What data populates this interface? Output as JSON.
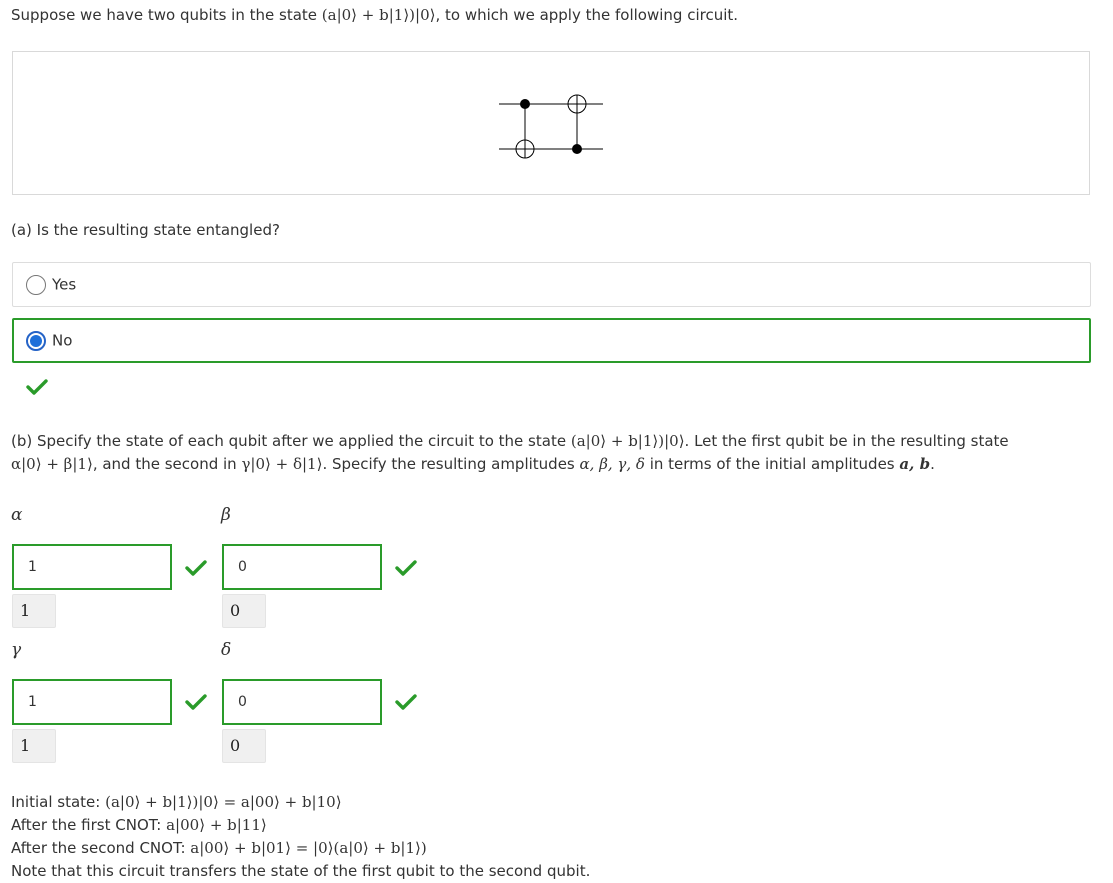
{
  "intro": {
    "prefix": "Suppose we have two qubits in the state",
    "state": "(a|0⟩ + b|1⟩)|0⟩",
    "suffix": ", to which we apply the following circuit."
  },
  "question_a": {
    "text": "(a) Is the resulting state entangled?",
    "options": [
      {
        "label": "Yes",
        "selected": false
      },
      {
        "label": "No",
        "selected": true
      }
    ],
    "result": "correct"
  },
  "question_b": {
    "p1": "(b) Specify the state of each qubit after we applied the circuit to the state",
    "state": "(a|0⟩ + b|1⟩)|0⟩",
    "p2": ". Let the first qubit be in the resulting state",
    "first_state": "α|0⟩ + β|1⟩",
    "p3": ", and the second in",
    "second_state": "γ|0⟩ + δ|1⟩",
    "p4": ". Specify the resulting amplitudes",
    "amps": "α, β, γ, δ",
    "p5": "in terms of the initial amplitudes",
    "initial": "a, b",
    "p6": "."
  },
  "answers": {
    "alpha": {
      "symbol": "α",
      "value": "1",
      "preview": "1",
      "result": "correct"
    },
    "beta": {
      "symbol": "β",
      "value": "0",
      "preview": "0",
      "result": "correct"
    },
    "gamma": {
      "symbol": "γ",
      "value": "1",
      "preview": "1",
      "result": "correct"
    },
    "delta": {
      "symbol": "δ",
      "value": "0",
      "preview": "0",
      "result": "correct"
    }
  },
  "solution": {
    "l1_label": "Initial state:",
    "l1_math": "(a|0⟩ + b|1⟩)|0⟩ = a|00⟩ + b|10⟩",
    "l2_label": "After the first CNOT:",
    "l2_math": "a|00⟩ + b|11⟩",
    "l3_label": "After the second CNOT:",
    "l3_math": "a|00⟩ + b|01⟩ = |0⟩(a|0⟩ + b|1⟩)",
    "l4": "Note that this circuit transfers the state of the first qubit to the second qubit."
  },
  "colors": {
    "correct_green": "#2a9b2a",
    "radio_blue": "#1e6fd9",
    "text": "#333333"
  }
}
